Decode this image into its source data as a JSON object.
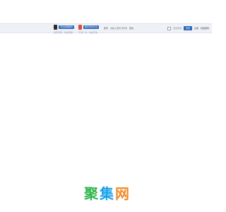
{
  "promo": [
    {
      "icon": "qr-code-icon",
      "button_label": "手机用网看景",
      "sub": "发现景观，快速查看"
    },
    {
      "icon": "qr-code-icon",
      "button_label": "看景手机平台",
      "sub": "下载一次，快速开发"
    }
  ],
  "login": {
    "label": "账号",
    "placeholder": "请输入账号/手机号/Email",
    "password_label": "密码"
  },
  "controls": {
    "remember": "自动登录",
    "login_button": "登录",
    "register": "注册",
    "forgot": "找回密码"
  },
  "watermark": {
    "chars": [
      "聚",
      "集",
      "网"
    ],
    "colors": [
      "#2fb54b",
      "#1aa3e8",
      "#f08a2a"
    ]
  },
  "colors": {
    "accent": "#2e66b8",
    "bar_bg": "#eef1f6"
  }
}
